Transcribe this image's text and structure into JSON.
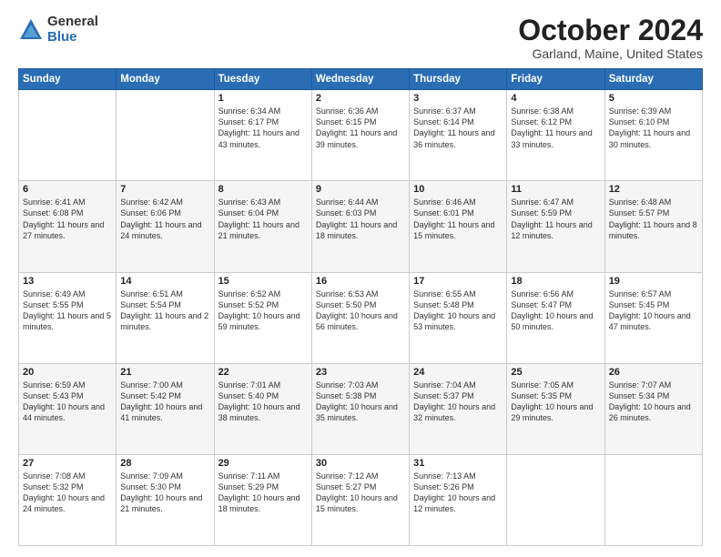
{
  "logo": {
    "general": "General",
    "blue": "Blue"
  },
  "header": {
    "title": "October 2024",
    "subtitle": "Garland, Maine, United States"
  },
  "days_of_week": [
    "Sunday",
    "Monday",
    "Tuesday",
    "Wednesday",
    "Thursday",
    "Friday",
    "Saturday"
  ],
  "weeks": [
    [
      {
        "day": "",
        "content": ""
      },
      {
        "day": "",
        "content": ""
      },
      {
        "day": "1",
        "content": "Sunrise: 6:34 AM\nSunset: 6:17 PM\nDaylight: 11 hours and 43 minutes."
      },
      {
        "day": "2",
        "content": "Sunrise: 6:36 AM\nSunset: 6:15 PM\nDaylight: 11 hours and 39 minutes."
      },
      {
        "day": "3",
        "content": "Sunrise: 6:37 AM\nSunset: 6:14 PM\nDaylight: 11 hours and 36 minutes."
      },
      {
        "day": "4",
        "content": "Sunrise: 6:38 AM\nSunset: 6:12 PM\nDaylight: 11 hours and 33 minutes."
      },
      {
        "day": "5",
        "content": "Sunrise: 6:39 AM\nSunset: 6:10 PM\nDaylight: 11 hours and 30 minutes."
      }
    ],
    [
      {
        "day": "6",
        "content": "Sunrise: 6:41 AM\nSunset: 6:08 PM\nDaylight: 11 hours and 27 minutes."
      },
      {
        "day": "7",
        "content": "Sunrise: 6:42 AM\nSunset: 6:06 PM\nDaylight: 11 hours and 24 minutes."
      },
      {
        "day": "8",
        "content": "Sunrise: 6:43 AM\nSunset: 6:04 PM\nDaylight: 11 hours and 21 minutes."
      },
      {
        "day": "9",
        "content": "Sunrise: 6:44 AM\nSunset: 6:03 PM\nDaylight: 11 hours and 18 minutes."
      },
      {
        "day": "10",
        "content": "Sunrise: 6:46 AM\nSunset: 6:01 PM\nDaylight: 11 hours and 15 minutes."
      },
      {
        "day": "11",
        "content": "Sunrise: 6:47 AM\nSunset: 5:59 PM\nDaylight: 11 hours and 12 minutes."
      },
      {
        "day": "12",
        "content": "Sunrise: 6:48 AM\nSunset: 5:57 PM\nDaylight: 11 hours and 8 minutes."
      }
    ],
    [
      {
        "day": "13",
        "content": "Sunrise: 6:49 AM\nSunset: 5:55 PM\nDaylight: 11 hours and 5 minutes."
      },
      {
        "day": "14",
        "content": "Sunrise: 6:51 AM\nSunset: 5:54 PM\nDaylight: 11 hours and 2 minutes."
      },
      {
        "day": "15",
        "content": "Sunrise: 6:52 AM\nSunset: 5:52 PM\nDaylight: 10 hours and 59 minutes."
      },
      {
        "day": "16",
        "content": "Sunrise: 6:53 AM\nSunset: 5:50 PM\nDaylight: 10 hours and 56 minutes."
      },
      {
        "day": "17",
        "content": "Sunrise: 6:55 AM\nSunset: 5:48 PM\nDaylight: 10 hours and 53 minutes."
      },
      {
        "day": "18",
        "content": "Sunrise: 6:56 AM\nSunset: 5:47 PM\nDaylight: 10 hours and 50 minutes."
      },
      {
        "day": "19",
        "content": "Sunrise: 6:57 AM\nSunset: 5:45 PM\nDaylight: 10 hours and 47 minutes."
      }
    ],
    [
      {
        "day": "20",
        "content": "Sunrise: 6:59 AM\nSunset: 5:43 PM\nDaylight: 10 hours and 44 minutes."
      },
      {
        "day": "21",
        "content": "Sunrise: 7:00 AM\nSunset: 5:42 PM\nDaylight: 10 hours and 41 minutes."
      },
      {
        "day": "22",
        "content": "Sunrise: 7:01 AM\nSunset: 5:40 PM\nDaylight: 10 hours and 38 minutes."
      },
      {
        "day": "23",
        "content": "Sunrise: 7:03 AM\nSunset: 5:38 PM\nDaylight: 10 hours and 35 minutes."
      },
      {
        "day": "24",
        "content": "Sunrise: 7:04 AM\nSunset: 5:37 PM\nDaylight: 10 hours and 32 minutes."
      },
      {
        "day": "25",
        "content": "Sunrise: 7:05 AM\nSunset: 5:35 PM\nDaylight: 10 hours and 29 minutes."
      },
      {
        "day": "26",
        "content": "Sunrise: 7:07 AM\nSunset: 5:34 PM\nDaylight: 10 hours and 26 minutes."
      }
    ],
    [
      {
        "day": "27",
        "content": "Sunrise: 7:08 AM\nSunset: 5:32 PM\nDaylight: 10 hours and 24 minutes."
      },
      {
        "day": "28",
        "content": "Sunrise: 7:09 AM\nSunset: 5:30 PM\nDaylight: 10 hours and 21 minutes."
      },
      {
        "day": "29",
        "content": "Sunrise: 7:11 AM\nSunset: 5:29 PM\nDaylight: 10 hours and 18 minutes."
      },
      {
        "day": "30",
        "content": "Sunrise: 7:12 AM\nSunset: 5:27 PM\nDaylight: 10 hours and 15 minutes."
      },
      {
        "day": "31",
        "content": "Sunrise: 7:13 AM\nSunset: 5:26 PM\nDaylight: 10 hours and 12 minutes."
      },
      {
        "day": "",
        "content": ""
      },
      {
        "day": "",
        "content": ""
      }
    ]
  ]
}
